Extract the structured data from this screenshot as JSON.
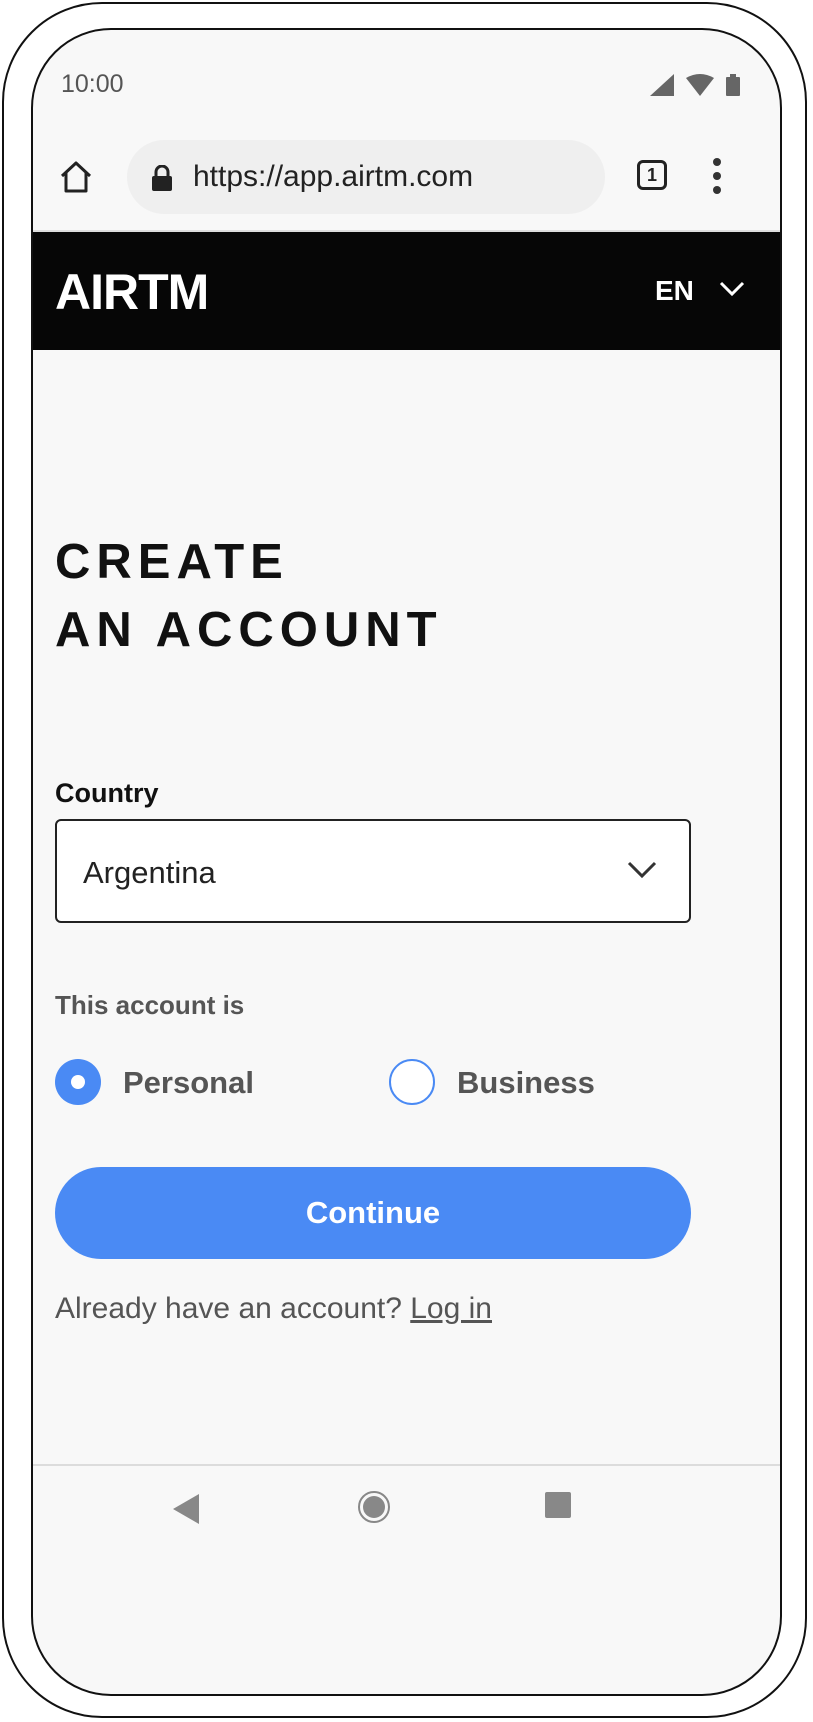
{
  "status_bar": {
    "time": "10:00"
  },
  "browser": {
    "url": "https://app.airtm.com",
    "tab_count": "1"
  },
  "header": {
    "logo_text": "AIRTM",
    "language": "EN"
  },
  "page": {
    "title_line1": "CREATE",
    "title_line2": "AN ACCOUNT",
    "country_label": "Country",
    "country_value": "Argentina",
    "account_type_label": "This account is",
    "account_types": [
      {
        "label": "Personal",
        "selected": true
      },
      {
        "label": "Business",
        "selected": false
      }
    ],
    "continue_label": "Continue",
    "login_prompt": "Already have an account?",
    "login_link": "Log in"
  },
  "colors": {
    "accent": "#4a8af4",
    "header_bg": "#060606"
  }
}
